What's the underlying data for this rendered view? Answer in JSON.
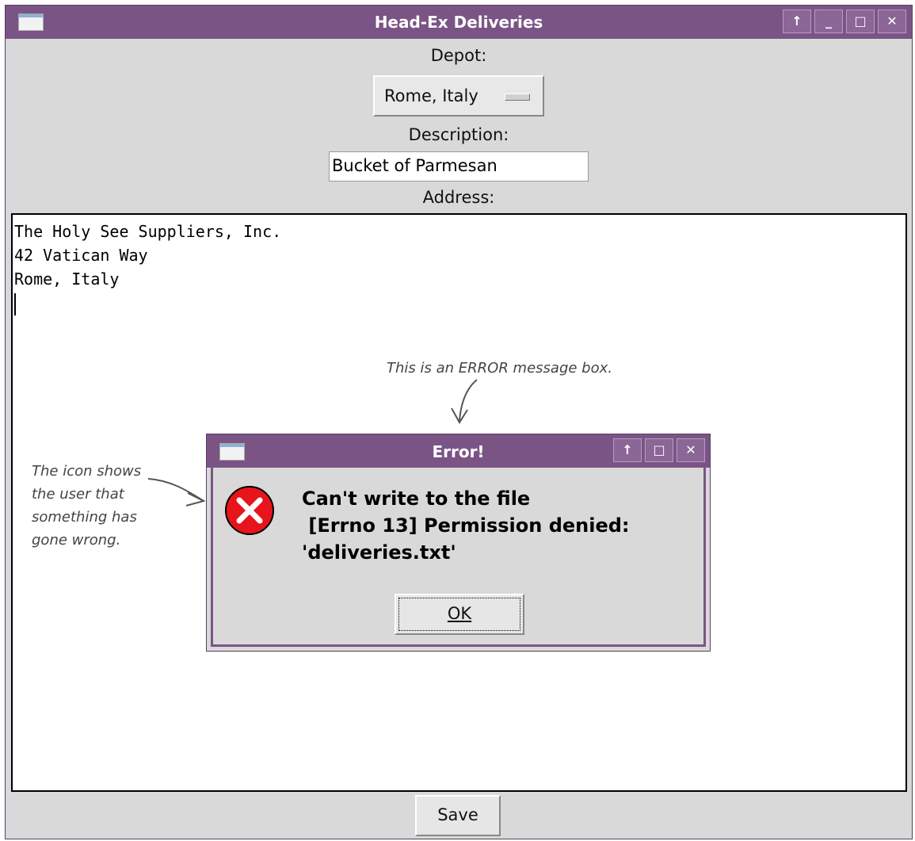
{
  "window": {
    "title": "Head-Ex Deliveries",
    "buttons": [
      "↑",
      "_",
      "□",
      "✕"
    ]
  },
  "form": {
    "depot_label": "Depot:",
    "depot_value": "Rome, Italy",
    "description_label": "Description:",
    "description_value": "Bucket of Parmesan",
    "address_label": "Address:",
    "address_lines": [
      "The Holy See Suppliers, Inc.",
      "42 Vatican Way",
      "Rome, Italy"
    ],
    "save_label": "Save"
  },
  "dialog": {
    "title": "Error!",
    "buttons": [
      "↑",
      "□",
      "✕"
    ],
    "message_line1": "Can't write to the file",
    "message_line2": " [Errno 13] Permission denied:",
    "message_line3": "'deliveries.txt'",
    "ok_label": "OK",
    "icon": "error-x-icon"
  },
  "annotations": {
    "top_note": "This is an ERROR message box.",
    "left_note_lines": [
      "The icon shows",
      "the user that",
      "something has",
      "gone wrong."
    ]
  },
  "colors": {
    "titlebar": "#7b5486",
    "window_bg": "#d9d9d9",
    "error_red": "#e8141b"
  }
}
